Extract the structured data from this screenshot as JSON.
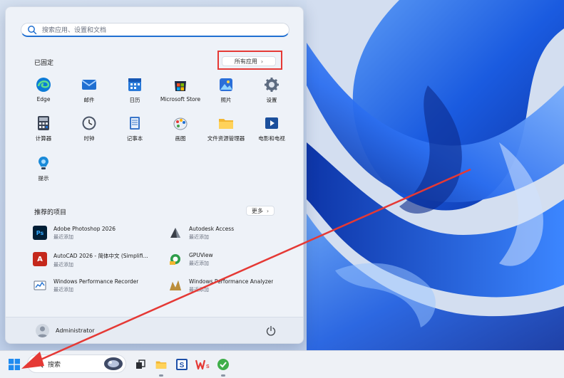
{
  "start_menu": {
    "search_placeholder": "搜索应用、设置和文档",
    "pinned_title": "已固定",
    "all_apps_label": "所有应用",
    "pinned_apps": [
      {
        "label": "Edge",
        "icon": "edge-icon"
      },
      {
        "label": "邮件",
        "icon": "mail-icon"
      },
      {
        "label": "日历",
        "icon": "calendar-icon"
      },
      {
        "label": "Microsoft Store",
        "icon": "store-icon"
      },
      {
        "label": "照片",
        "icon": "photos-icon"
      },
      {
        "label": "设置",
        "icon": "gear-icon"
      },
      {
        "label": "计算器",
        "icon": "calculator-icon"
      },
      {
        "label": "时钟",
        "icon": "clock-icon"
      },
      {
        "label": "记事本",
        "icon": "notepad-icon"
      },
      {
        "label": "画图",
        "icon": "paint-icon"
      },
      {
        "label": "文件资源管理器",
        "icon": "folder-icon"
      },
      {
        "label": "电影和电视",
        "icon": "movies-icon"
      },
      {
        "label": "提示",
        "icon": "tips-icon"
      }
    ],
    "recommended_title": "推荐的项目",
    "more_label": "更多",
    "recommended": [
      {
        "name": "Adobe Photoshop 2026",
        "sub": "最近添加",
        "icon": "photoshop-icon"
      },
      {
        "name": "Autodesk Access",
        "sub": "最近添加",
        "icon": "autodesk-access-icon"
      },
      {
        "name": "AutoCAD 2026 - 简体中文 (Simplifi...",
        "sub": "最近添加",
        "icon": "autocad-icon"
      },
      {
        "name": "GPUView",
        "sub": "最近添加",
        "icon": "gpuview-icon"
      },
      {
        "name": "Windows Performance Recorder",
        "sub": "最近添加",
        "icon": "perf-recorder-icon"
      },
      {
        "name": "Windows Performance Analyzer",
        "sub": "最近添加",
        "icon": "perf-analyzer-icon"
      }
    ],
    "user_name": "Administrator"
  },
  "taskbar": {
    "search_label": "搜索"
  },
  "colors": {
    "accent": "#1f6fd1",
    "annotation_red": "#e53935",
    "wallpaper_blue": "#1a5be0"
  }
}
